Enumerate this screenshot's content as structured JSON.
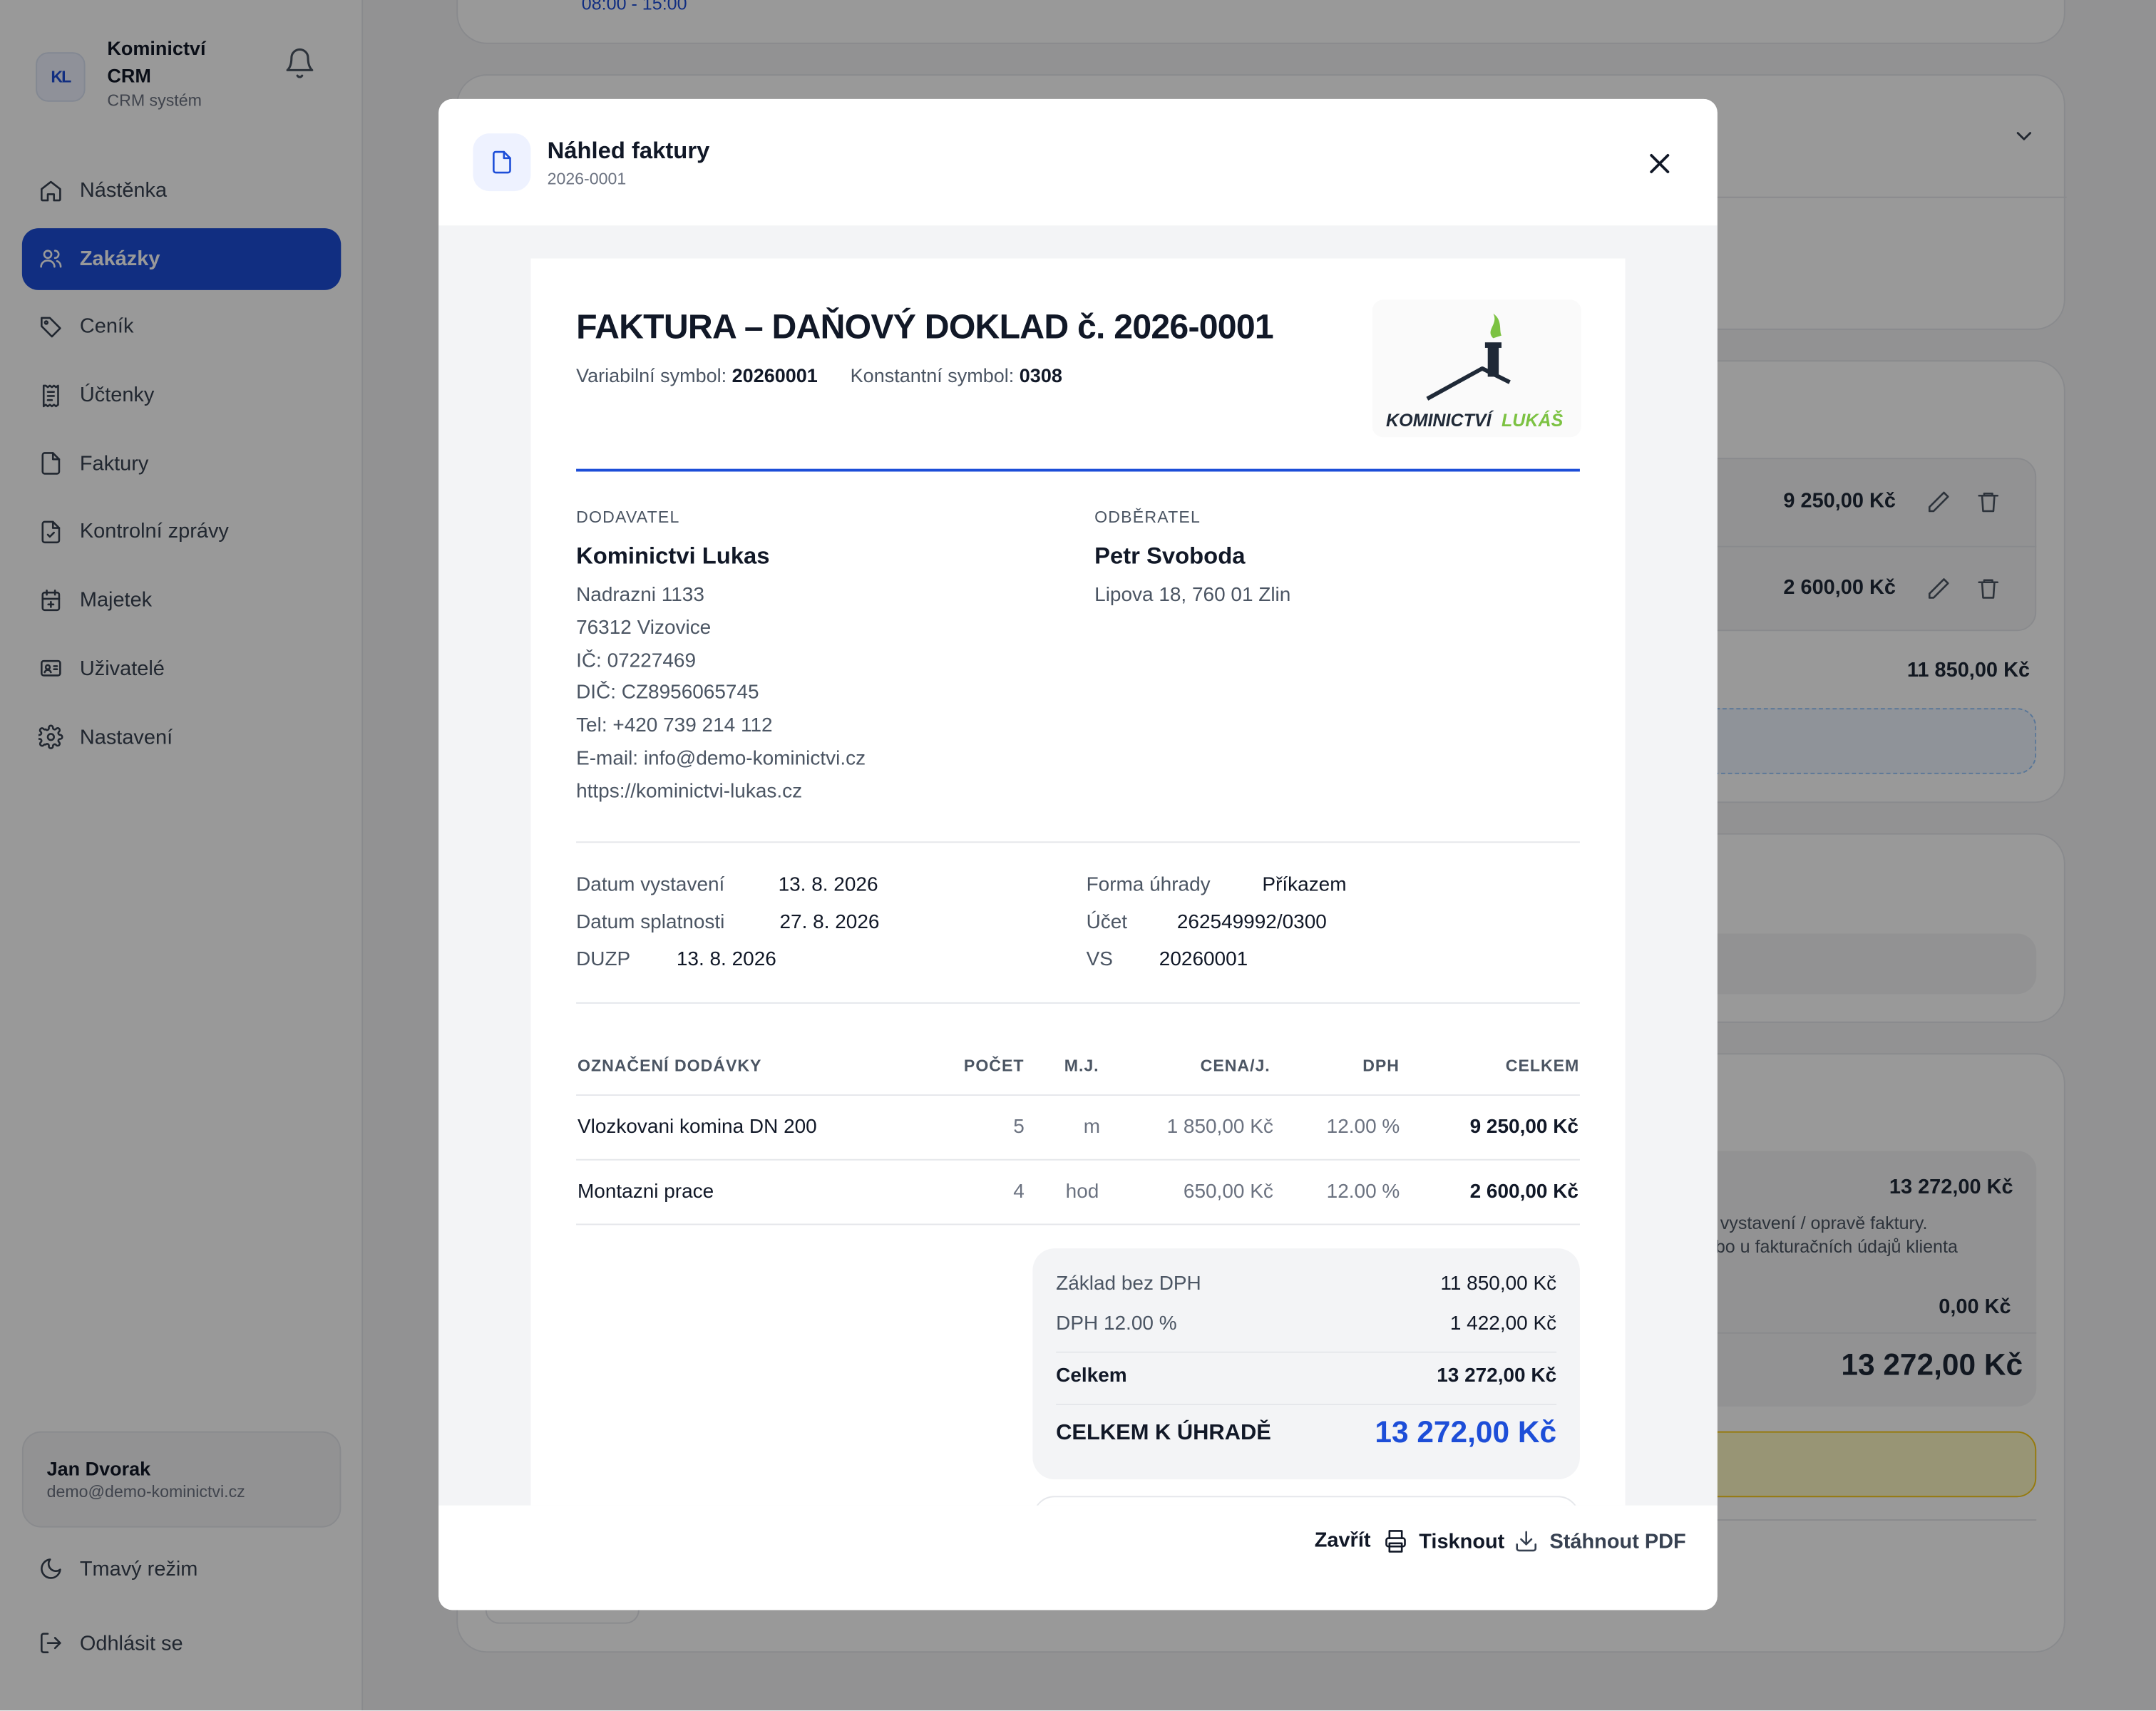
{
  "app": {
    "brand_name": "Kominictví CRM",
    "brand_sub": "CRM systém",
    "logo_text": "KL"
  },
  "sidebar": {
    "items": [
      {
        "label": "Nástěnka",
        "icon": "home-icon"
      },
      {
        "label": "Zakázky",
        "icon": "users-icon",
        "active": true
      },
      {
        "label": "Ceník",
        "icon": "tag-icon"
      },
      {
        "label": "Účtenky",
        "icon": "receipt-icon"
      },
      {
        "label": "Faktury",
        "icon": "file-icon"
      },
      {
        "label": "Kontrolní zprávy",
        "icon": "file-check-icon"
      },
      {
        "label": "Majetek",
        "icon": "calendar-icon"
      },
      {
        "label": "Uživatelé",
        "icon": "id-card-icon"
      },
      {
        "label": "Nastavení",
        "icon": "gear-icon"
      }
    ],
    "user": {
      "name": "Jan Dvorak",
      "email": "demo@demo-kominictvi.cz"
    },
    "dark_mode": "Tmavý režim",
    "logout": "Odhlásit se"
  },
  "background": {
    "time": "08:00 - 15:00",
    "row1_amount": "9 250,00 Kč",
    "row2_amount": "2 600,00 Kč",
    "subtotal": "11 850,00 Kč",
    "total_small": "13 272,00 Kč",
    "note_line1": "při vystavení / opravě faktury.",
    "note_line2": "nebo u fakturačních údajů klienta",
    "zero": "0,00 Kč",
    "total_big": "13 272,00 Kč"
  },
  "modal": {
    "title": "Náhled faktury",
    "subtitle": "2026-0001",
    "footer": {
      "close": "Zavřít",
      "print": "Tisknout",
      "download": "Stáhnout PDF"
    }
  },
  "invoice": {
    "title": "FAKTURA – DAŇOVÝ DOKLAD č. 2026-0001",
    "vs_label": "Variabilní symbol:",
    "vs_value": "20260001",
    "ks_label": "Konstantní symbol:",
    "ks_value": "0308",
    "logo_word1": "KOMINICTVÍ",
    "logo_word2": "LUKÁŠ",
    "supplier": {
      "label": "DODAVATEL",
      "name": "Kominictvi Lukas",
      "lines": [
        "Nadrazni 1133",
        "76312 Vizovice",
        "IČ: 07227469",
        "DIČ: CZ8956065745",
        "Tel: +420 739 214 112",
        "E-mail: info@demo-kominictvi.cz",
        "https://kominictvi-lukas.cz"
      ]
    },
    "customer": {
      "label": "ODBĚRATEL",
      "name": "Petr Svoboda",
      "address": "Lipova 18, 760 01 Zlin"
    },
    "dates": {
      "issued_label": "Datum vystavení",
      "issued": "13. 8. 2026",
      "due_label": "Datum splatnosti",
      "due": "27. 8. 2026",
      "duzp_label": "DUZP",
      "duzp": "13. 8. 2026"
    },
    "payment": {
      "method_label": "Forma úhrady",
      "method": "Příkazem",
      "account_label": "Účet",
      "account": "262549992/0300",
      "vs_label": "VS",
      "vs": "20260001"
    },
    "table": {
      "headers": [
        "OZNAČENÍ DODÁVKY",
        "POČET",
        "M.J.",
        "CENA/J.",
        "DPH",
        "CELKEM"
      ],
      "rows": [
        [
          "Vlozkovani komina DN 200",
          "5",
          "m",
          "1 850,00 Kč",
          "12.00 %",
          "9 250,00 Kč"
        ],
        [
          "Montazni prace",
          "4",
          "hod",
          "650,00 Kč",
          "12.00 %",
          "2 600,00 Kč"
        ]
      ]
    },
    "summary": {
      "base_label": "Základ bez DPH",
      "base": "11 850,00 Kč",
      "vat_label": "DPH 12.00 %",
      "vat": "1 422,00 Kč",
      "total_label": "Celkem",
      "total": "13 272,00 Kč",
      "due_label": "CELKEM K ÚHRADĚ",
      "due": "13 272,00 Kč"
    }
  },
  "colors": {
    "accent": "#1d4ed8",
    "logo_green": "#7cc242"
  }
}
